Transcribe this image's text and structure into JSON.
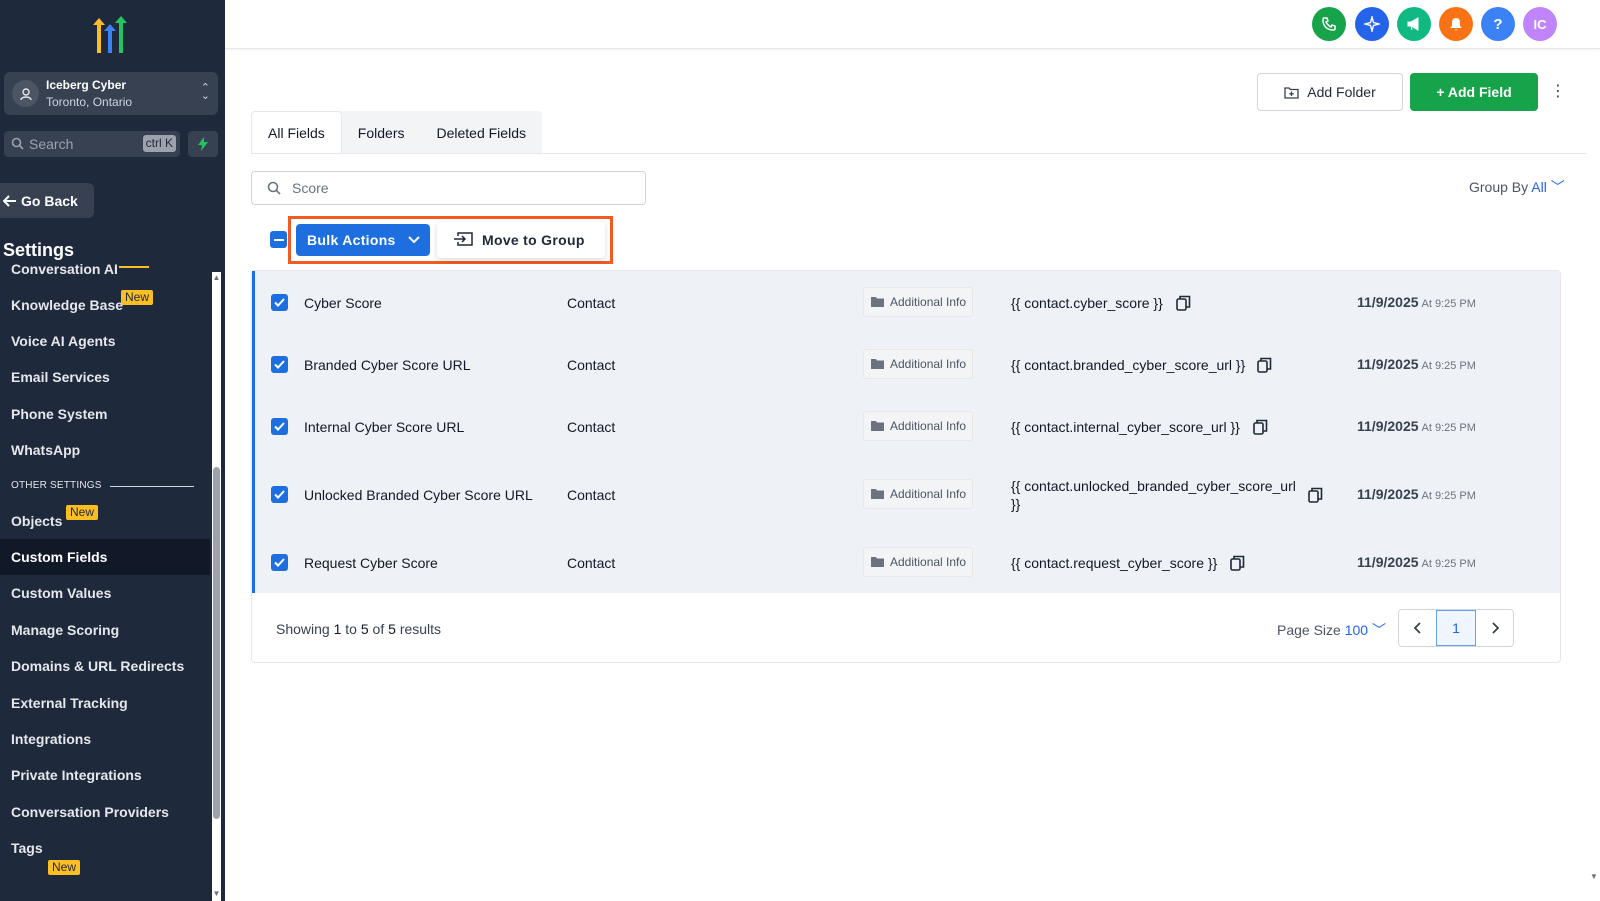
{
  "sidebar": {
    "account": {
      "name": "Iceberg Cyber",
      "location": "Toronto, Ontario"
    },
    "search": {
      "placeholder": "Search",
      "shortcut": "ctrl K"
    },
    "go_back": "Go Back",
    "title": "Settings",
    "items": [
      {
        "label": "Conversation AI",
        "badge": ""
      },
      {
        "label": "Knowledge Base",
        "badge": "New"
      },
      {
        "label": "Voice AI Agents",
        "badge": ""
      },
      {
        "label": "Email Services",
        "badge": ""
      },
      {
        "label": "Phone System",
        "badge": ""
      },
      {
        "label": "WhatsApp",
        "badge": ""
      }
    ],
    "section_label": "OTHER SETTINGS",
    "items2": [
      {
        "label": "Objects",
        "badge": "New"
      },
      {
        "label": "Custom Fields",
        "badge": "",
        "active": true
      },
      {
        "label": "Custom Values",
        "badge": ""
      },
      {
        "label": "Manage Scoring",
        "badge": ""
      },
      {
        "label": "Domains & URL Redirects",
        "badge": ""
      },
      {
        "label": "External Tracking",
        "badge": ""
      },
      {
        "label": "Integrations",
        "badge": ""
      },
      {
        "label": "Private Integrations",
        "badge": ""
      },
      {
        "label": "Conversation Providers",
        "badge": ""
      },
      {
        "label": "Tags",
        "badge": "New"
      }
    ]
  },
  "topbar": {
    "icons": [
      {
        "name": "phone-icon",
        "color": "#16a34a"
      },
      {
        "name": "sparkle-icon",
        "color": "#2563eb"
      },
      {
        "name": "megaphone-icon",
        "color": "#10b981"
      },
      {
        "name": "bell-icon",
        "color": "#f97316"
      },
      {
        "name": "help-icon",
        "color": "#3b82f6"
      },
      {
        "name": "user-avatar",
        "color": "#c084fc"
      }
    ],
    "avatar_initials": "IC",
    "help_glyph": "?"
  },
  "main": {
    "add_folder": "Add Folder",
    "add_field": "+ Add Field",
    "tabs": [
      "All Fields",
      "Folders",
      "Deleted Fields"
    ],
    "search": {
      "value": "Score"
    },
    "group_by": {
      "label": "Group By",
      "value": "All"
    },
    "bulk_actions": "Bulk Actions",
    "move_to_group": "Move to Group",
    "rows": [
      {
        "name": "Cyber Score",
        "object": "Contact",
        "folder": "Additional Info",
        "key": "{{ contact.cyber_score }}",
        "date": "11/9/2025",
        "time": "At 9:25 PM"
      },
      {
        "name": "Branded Cyber Score URL",
        "object": "Contact",
        "folder": "Additional Info",
        "key": "{{ contact.branded_cyber_score_url }}",
        "date": "11/9/2025",
        "time": "At 9:25 PM"
      },
      {
        "name": "Internal Cyber Score URL",
        "object": "Contact",
        "folder": "Additional Info",
        "key": "{{ contact.internal_cyber_score_url }}",
        "date": "11/9/2025",
        "time": "At 9:25 PM"
      },
      {
        "name": "Unlocked Branded Cyber Score URL",
        "object": "Contact",
        "folder": "Additional Info",
        "key": "{{ contact.unlocked_branded_cyber_score_url }}",
        "date": "11/9/2025",
        "time": "At 9:25 PM"
      },
      {
        "name": "Request Cyber Score",
        "object": "Contact",
        "folder": "Additional Info",
        "key": "{{ contact.request_cyber_score }}",
        "date": "11/9/2025",
        "time": "At 9:25 PM"
      }
    ],
    "showing": {
      "prefix": "Showing",
      "from": "1",
      "to_word": "to",
      "to": "5",
      "of_word": "of",
      "total": "5",
      "suffix": "results"
    },
    "page_size": {
      "label": "Page Size",
      "value": "100"
    },
    "pagination": {
      "current": "1"
    }
  },
  "colors": {
    "accent": "#1d6fe0",
    "sidebar_bg": "#1e293b",
    "add_field_bg": "#16a34a",
    "highlight": "#f15a22"
  }
}
